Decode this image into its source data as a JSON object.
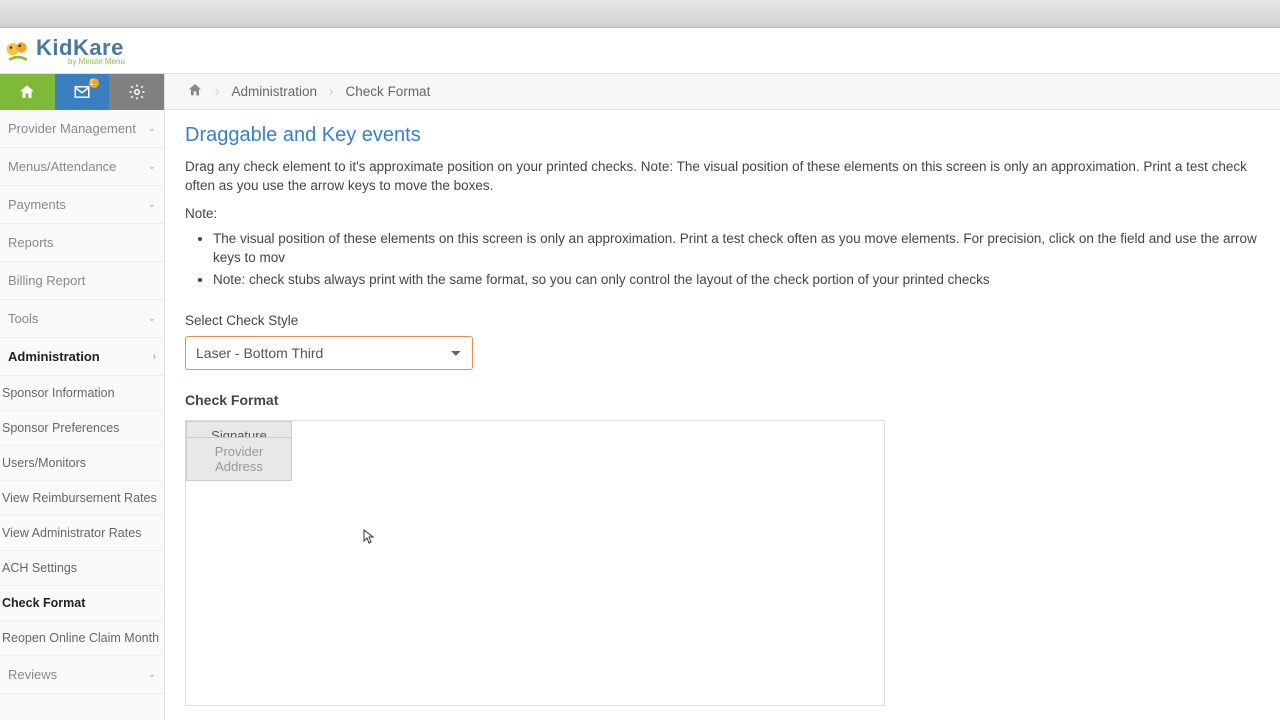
{
  "logo": {
    "text": "KidKare",
    "sub": "by Minute Menu"
  },
  "icon_bar": {
    "badge": "1"
  },
  "sidebar": {
    "sections": [
      {
        "label": "Provider Management",
        "expandable": true
      },
      {
        "label": "Menus/Attendance",
        "expandable": true
      },
      {
        "label": "Payments",
        "expandable": true
      },
      {
        "label": "Reports",
        "expandable": false
      },
      {
        "label": "Billing Report",
        "expandable": false
      },
      {
        "label": "Tools",
        "expandable": true
      },
      {
        "label": "Administration",
        "expandable": true,
        "active": true
      },
      {
        "label": "Reviews",
        "expandable": true
      }
    ],
    "admin_subs": [
      {
        "label": "Sponsor Information"
      },
      {
        "label": "Sponsor Preferences"
      },
      {
        "label": "Users/Monitors"
      },
      {
        "label": "View Reimbursement Rates"
      },
      {
        "label": "View Administrator Rates"
      },
      {
        "label": "ACH Settings"
      },
      {
        "label": "Check Format",
        "selected": true
      },
      {
        "label": "Reopen Online Claim Month"
      }
    ]
  },
  "breadcrumb": {
    "home_aria": "Home",
    "a": "Administration",
    "b": "Check Format"
  },
  "page": {
    "title": "Draggable and Key events",
    "intro": "Drag any check element to it's approximate position on your printed checks. Note: The visual position of these elements on this screen is only an approximation. Print a test check often as you use the arrow keys to move the boxes.",
    "note_label": "Note:",
    "notes": [
      "The visual position of these elements on this screen is only an approximation. Print a test check often as you move elements. For precision, click on the field and use the arrow keys to mov",
      "Note: check stubs always print with the same format, so you can only control the layout of the check portion of your printed checks"
    ],
    "select_label": "Select Check Style",
    "select_value": "Laser - Bottom Third",
    "format_label": "Check Format",
    "elements": {
      "signature": "Signature",
      "provider_address": "Provider Address"
    }
  }
}
